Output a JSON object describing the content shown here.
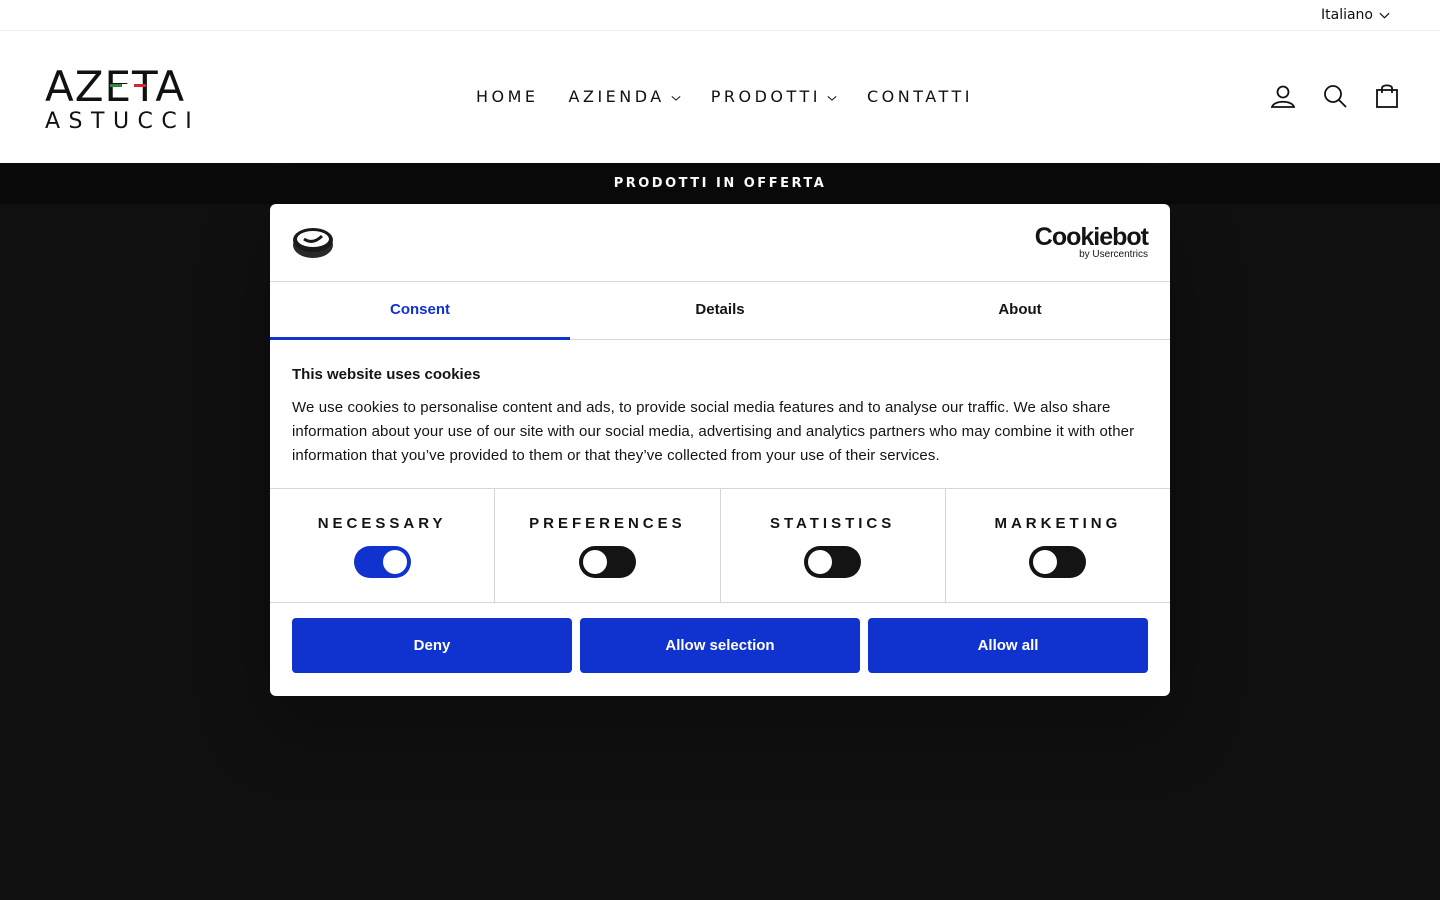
{
  "utility": {
    "language": "Italiano"
  },
  "brand": {
    "logo_top": "AZETA",
    "logo_bottom": "ASTUCCI",
    "flag_colors": [
      "#2e8b3a",
      "#ffffff",
      "#d7262e"
    ]
  },
  "nav": {
    "items": [
      {
        "label": "HOME",
        "has_dropdown": false
      },
      {
        "label": "AZIENDA",
        "has_dropdown": true
      },
      {
        "label": "PRODOTTI",
        "has_dropdown": true
      },
      {
        "label": "CONTATTI",
        "has_dropdown": false
      }
    ]
  },
  "header_icons": [
    "user-icon",
    "search-icon",
    "shopping-bag-icon"
  ],
  "announcement": "PRODOTTI IN OFFERTA",
  "cookie_dialog": {
    "brand_name": "Cookiebot",
    "brand_sub": "by Usercentrics",
    "tabs": [
      {
        "label": "Consent",
        "active": true
      },
      {
        "label": "Details",
        "active": false
      },
      {
        "label": "About",
        "active": false
      }
    ],
    "heading": "This website uses cookies",
    "body": "We use cookies to personalise content and ads, to provide social media features and to analyse our traffic. We also share information about your use of our site with our social media, advertising and analytics partners who may combine it with other information that you’ve provided to them or that they’ve collected from your use of their services.",
    "categories": [
      {
        "label": "NECESSARY",
        "enabled": true
      },
      {
        "label": "PREFERENCES",
        "enabled": false
      },
      {
        "label": "STATISTICS",
        "enabled": false
      },
      {
        "label": "MARKETING",
        "enabled": false
      }
    ],
    "buttons": {
      "deny": "Deny",
      "allow_selection": "Allow selection",
      "allow_all": "Allow all"
    },
    "accent_color": "#1032cf"
  }
}
